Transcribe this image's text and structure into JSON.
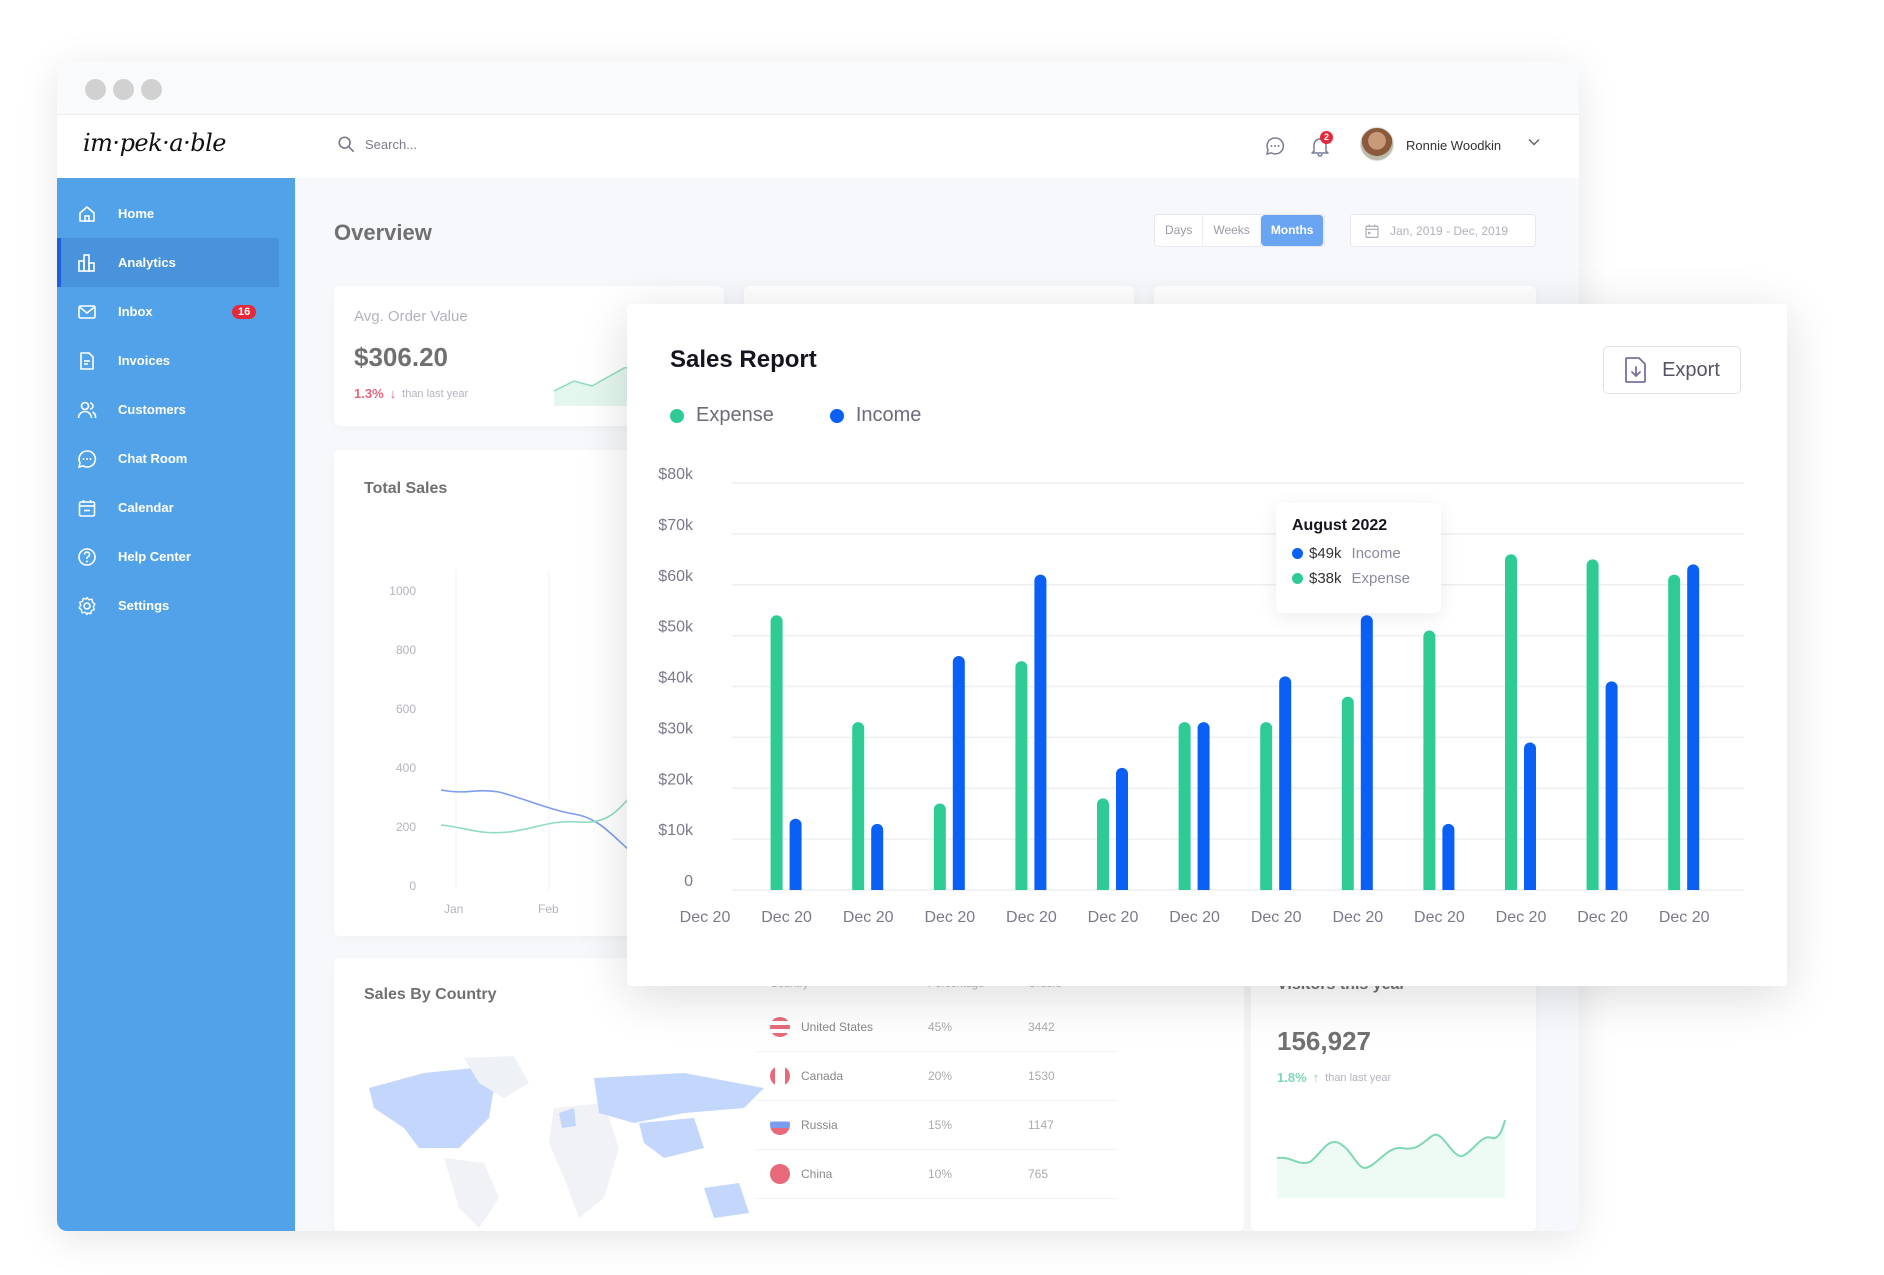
{
  "window": {
    "controls": [
      "close",
      "minimize",
      "maximize"
    ]
  },
  "header": {
    "logo": "im·pek·a·ble",
    "search_placeholder": "Search...",
    "notification_count": "2",
    "user_name": "Ronnie Woodkin"
  },
  "sidebar": {
    "items": [
      {
        "label": "Home",
        "icon": "home-icon"
      },
      {
        "label": "Analytics",
        "icon": "analytics-icon",
        "active": true
      },
      {
        "label": "Inbox",
        "icon": "mail-icon",
        "badge": "16"
      },
      {
        "label": "Invoices",
        "icon": "invoice-icon"
      },
      {
        "label": "Customers",
        "icon": "users-icon"
      },
      {
        "label": "Chat Room",
        "icon": "chat-icon"
      },
      {
        "label": "Calendar",
        "icon": "calendar-icon"
      },
      {
        "label": "Help Center",
        "icon": "help-icon"
      },
      {
        "label": "Settings",
        "icon": "gear-icon"
      }
    ]
  },
  "overview": {
    "title": "Overview",
    "periods": [
      "Days",
      "Weeks",
      "Months"
    ],
    "selected_period": "Months",
    "date_range": "Jan, 2019 - Dec, 2019"
  },
  "avg_order": {
    "label": "Avg. Order Value",
    "value": "$306.20",
    "change": "1.3%",
    "change_direction": "down",
    "change_suffix": "than last year"
  },
  "total_sales": {
    "title": "Total Sales",
    "y_ticks": [
      "1000",
      "800",
      "600",
      "400",
      "200",
      "0"
    ],
    "x_ticks": [
      "Jan",
      "Feb"
    ]
  },
  "sales_by_country": {
    "title": "Sales By Country",
    "columns": [
      "Country",
      "Percentage",
      "Orders"
    ],
    "rows": [
      {
        "country": "United States",
        "percentage": "45%",
        "orders": "3442",
        "flag": "us-flag-icon"
      },
      {
        "country": "Canada",
        "percentage": "20%",
        "orders": "1530",
        "flag": "canada-flag-icon"
      },
      {
        "country": "Russia",
        "percentage": "15%",
        "orders": "1147",
        "flag": "russia-flag-icon"
      },
      {
        "country": "China",
        "percentage": "10%",
        "orders": "765",
        "flag": "china-flag-icon"
      }
    ]
  },
  "visitors": {
    "title": "Visitors this year",
    "value": "156,927",
    "change": "1.8%",
    "change_direction": "up",
    "change_suffix": "than last year"
  },
  "sales_report": {
    "title": "Sales Report",
    "export_label": "Export",
    "tooltip": {
      "title": "August 2022",
      "income_value": "$49k",
      "income_label": "Income",
      "expense_value": "$38k",
      "expense_label": "Expense"
    }
  },
  "colors": {
    "expense": "#2ecc94",
    "income": "#0a5ff5",
    "sidebar": "#52a2ea",
    "accent": "#6aa5f3",
    "badge": "#e5293a"
  },
  "chart_data": {
    "type": "bar",
    "title": "Sales Report",
    "xlabel": "",
    "ylabel": "",
    "ylim": [
      0,
      80000
    ],
    "y_ticks": [
      "$80k",
      "$70k",
      "$60k",
      "$50k",
      "$40k",
      "$30k",
      "$20k",
      "$10k",
      "0"
    ],
    "x_tick_labels": [
      "Dec 20",
      "Dec 20",
      "Dec 20",
      "Dec 20",
      "Dec 20",
      "Dec 20",
      "Dec 20",
      "Dec 20",
      "Dec 20",
      "Dec 20",
      "Dec 20",
      "Dec 20",
      "Dec 20"
    ],
    "categories": [
      "Dec 20",
      "Dec 20",
      "Dec 20",
      "Dec 20",
      "Dec 20",
      "Dec 20",
      "Dec 20",
      "Dec 20",
      "Dec 20",
      "Dec 20",
      "Dec 20",
      "Dec 20"
    ],
    "series": [
      {
        "name": "Expense",
        "color": "#2ecc94",
        "values": [
          54000,
          33000,
          17000,
          45000,
          18000,
          33000,
          33000,
          38000,
          51000,
          66000,
          65000,
          62000
        ]
      },
      {
        "name": "Income",
        "color": "#0a5ff5",
        "values": [
          14000,
          13000,
          46000,
          62000,
          24000,
          33000,
          42000,
          54000,
          13000,
          29000,
          41000,
          64000
        ]
      }
    ],
    "legend": "top-left",
    "grid": true
  }
}
